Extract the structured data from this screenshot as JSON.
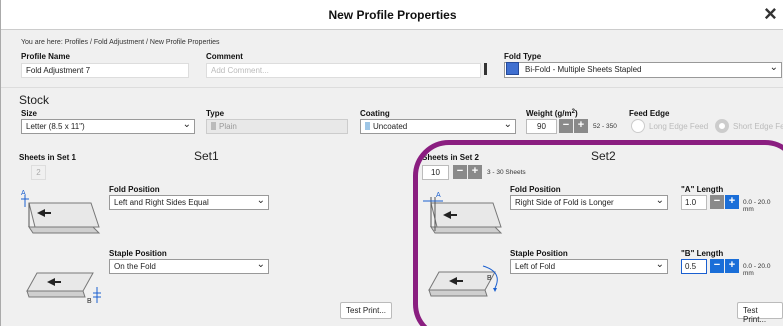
{
  "window": {
    "title": "New Profile Properties",
    "close": "×"
  },
  "breadcrumb": "You are here: Profiles / Fold Adjustment / New Profile Properties",
  "profile": {
    "name_label": "Profile Name",
    "name_value": "Fold Adjustment 7",
    "comment_label": "Comment",
    "comment_placeholder": "Add Comment...",
    "fold_type_label": "Fold Type",
    "fold_type_value": "Bi-Fold - Multiple Sheets Stapled"
  },
  "stock": {
    "heading": "Stock",
    "size_label": "Size",
    "size_value": "Letter (8.5 x 11\")",
    "type_label": "Type",
    "type_value": "Plain",
    "coating_label": "Coating",
    "coating_value": "Uncoated",
    "weight_label": "Weight (g/m",
    "weight_sup": "2",
    "weight_label_end": ")",
    "weight_value": "90",
    "weight_range": "52 - 350",
    "feed_edge_label": "Feed Edge",
    "feed_long": "Long Edge Feed",
    "feed_short": "Short Edge Fe"
  },
  "set1": {
    "heading": "Set1",
    "sheets_label": "Sheets in Set 1",
    "sheets_value": "2",
    "fold_position_label": "Fold Position",
    "fold_position_value": "Left and Right Sides Equal",
    "staple_position_label": "Staple Position",
    "staple_position_value": "On the Fold",
    "test_print": "Test Print..."
  },
  "set2": {
    "heading": "Set2",
    "sheets_label": "Sheets in Set 2",
    "sheets_value": "10",
    "sheets_range": "3 - 30 Sheets",
    "fold_position_label": "Fold Position",
    "fold_position_value": "Right Side of Fold is Longer",
    "a_length_label": "\"A\" Length",
    "a_length_value": "1.0",
    "a_length_range": "0.0 - 20.0 mm",
    "staple_position_label": "Staple Position",
    "staple_position_value": "Left of Fold",
    "b_length_label": "\"B\" Length",
    "b_length_value": "0.5",
    "b_length_range": "0.0 - 20.0 mm",
    "test_print": "Test Print..."
  },
  "steppers": {
    "minus": "−",
    "plus": "+"
  },
  "diagram_labels": {
    "a": "A",
    "b": "B"
  },
  "colors": {
    "highlight": "#8a1e80",
    "accent_blue": "#1a6ed8",
    "stepper_gray": "#8a8a8a"
  },
  "icons": [
    "close-icon",
    "chevron-down-icon",
    "bifold-icon",
    "fold-diagram-icon",
    "staple-diagram-icon"
  ]
}
